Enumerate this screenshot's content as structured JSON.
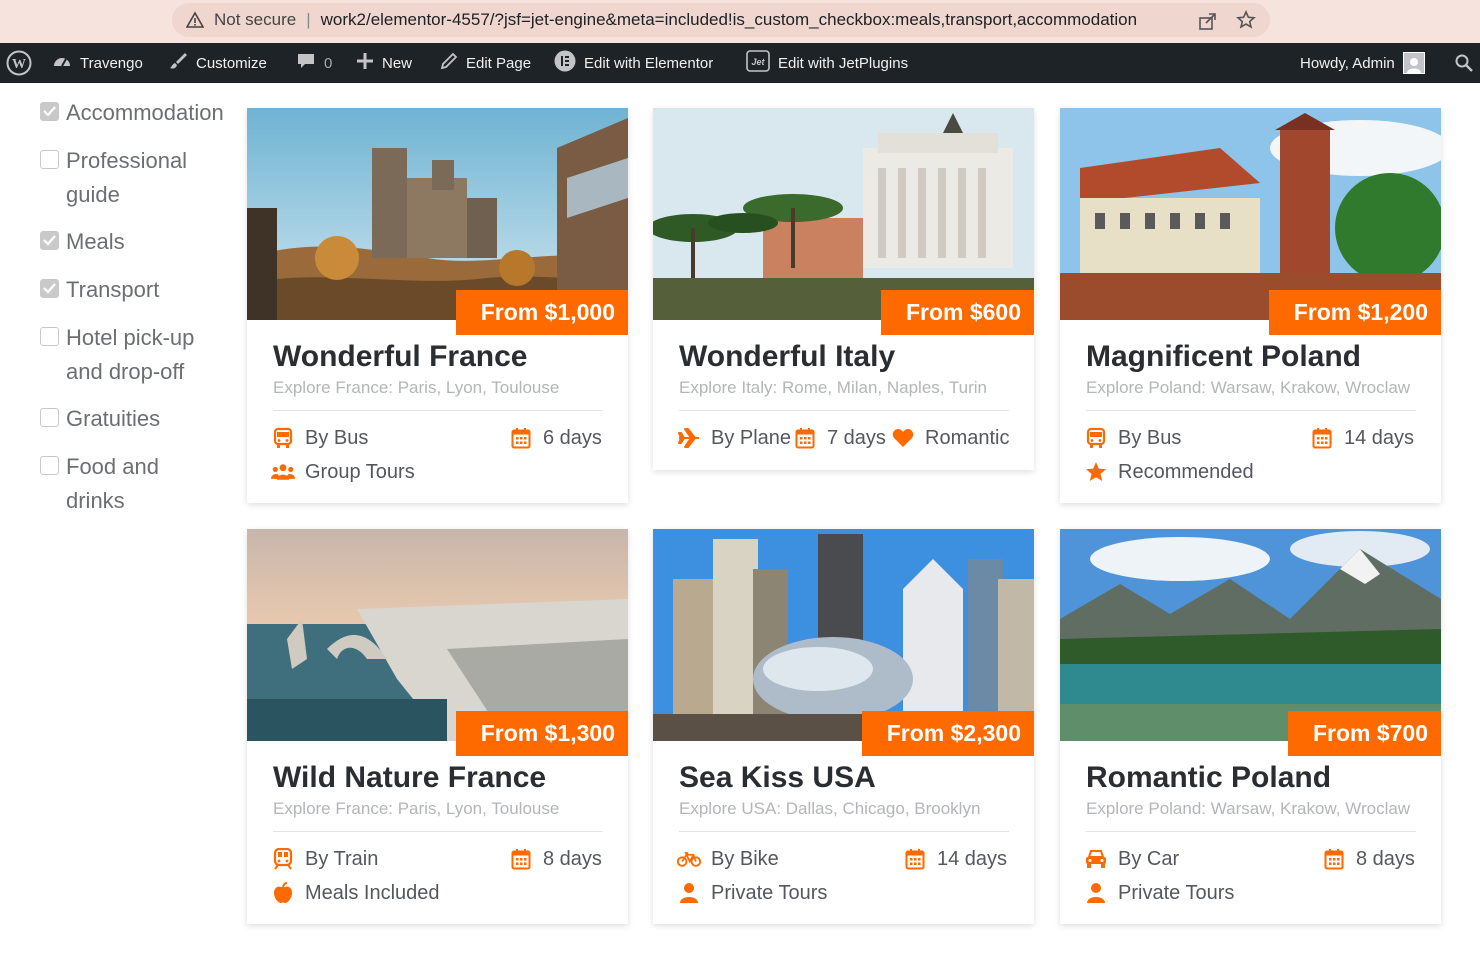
{
  "browser": {
    "not_secure": "Not secure",
    "url": "work2/elementor-4557/?jsf=jet-engine&meta=included!is_custom_checkbox:meals,transport,accommodation"
  },
  "adminbar": {
    "site": "Travengo",
    "customize": "Customize",
    "comments": "0",
    "new": "New",
    "edit_page": "Edit Page",
    "edit_elementor": "Edit with Elementor",
    "edit_jet": "Edit with JetPlugins",
    "howdy": "Howdy, Admin"
  },
  "filters": [
    {
      "line1": "Accommodation",
      "line2": "",
      "checked": true
    },
    {
      "line1": "Professional",
      "line2": "guide",
      "checked": false
    },
    {
      "line1": "Meals",
      "line2": "",
      "checked": true
    },
    {
      "line1": "Transport",
      "line2": "",
      "checked": true
    },
    {
      "line1": "Hotel pick-up",
      "line2": "and drop-off",
      "checked": false
    },
    {
      "line1": "Gratuities",
      "line2": "",
      "checked": false
    },
    {
      "line1": "Food and",
      "line2": "drinks",
      "checked": false
    }
  ],
  "accent_color": "#ff6a00",
  "tours": [
    {
      "title": "Wonderful France",
      "subtitle": "Explore France: Paris, Lyon, Toulouse",
      "price": "From $1,000",
      "transport": "By Bus",
      "transport_icon": "bus-icon",
      "duration": "6 days",
      "tag": "Group Tours",
      "tag_icon": "group-icon"
    },
    {
      "title": "Wonderful Italy",
      "subtitle": "Explore Italy: Rome, Milan, Naples, Turin",
      "price": "From $600",
      "transport": "By Plane",
      "transport_icon": "plane-icon",
      "duration": "7 days",
      "tag": "Romantic",
      "tag_icon": "heart-icon"
    },
    {
      "title": "Magnificent Poland",
      "subtitle": "Explore Poland: Warsaw, Krakow, Wroclaw",
      "price": "From $1,200",
      "transport": "By Bus",
      "transport_icon": "bus-icon",
      "duration": "14 days",
      "tag": "Recommended",
      "tag_icon": "star-icon"
    },
    {
      "title": "Wild Nature France",
      "subtitle": "Explore France: Paris, Lyon, Toulouse",
      "price": "From $1,300",
      "transport": "By Train",
      "transport_icon": "train-icon",
      "duration": "8 days",
      "tag": "Meals Included",
      "tag_icon": "apple-icon"
    },
    {
      "title": "Sea Kiss USA",
      "subtitle": "Explore USA: Dallas, Chicago, Brooklyn",
      "price": "From $2,300",
      "transport": "By Bike",
      "transport_icon": "bike-icon",
      "duration": "14 days",
      "tag": "Private Tours",
      "tag_icon": "user-icon"
    },
    {
      "title": "Romantic Poland",
      "subtitle": "Explore Poland: Warsaw, Krakow, Wroclaw",
      "price": "From $700",
      "transport": "By Car",
      "transport_icon": "car-icon",
      "duration": "8 days",
      "tag": "Private Tours",
      "tag_icon": "user-icon"
    }
  ]
}
